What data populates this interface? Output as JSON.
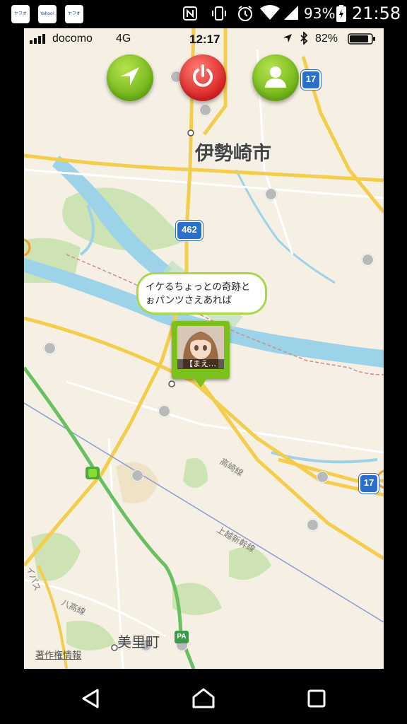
{
  "android_status": {
    "notifications": [
      "ヤフオク!",
      "Yahoo!カード",
      "ヤフオク!"
    ],
    "battery": "93%",
    "time": "21:58"
  },
  "ios_status": {
    "carrier": "docomo",
    "network": "4G",
    "time": "12:17",
    "battery": "82%"
  },
  "controls": {
    "locate_icon": "location-arrow-icon",
    "power_icon": "power-icon",
    "profile_icon": "person-icon"
  },
  "map": {
    "city_label": "伊勢崎市",
    "town_label": "美里町",
    "copyright_label": "著作権情報",
    "route_shields": [
      "17",
      "462",
      "17"
    ],
    "line_labels": [
      "高崎線",
      "上越新幹線",
      "八高線",
      "イパス"
    ],
    "pa_badge": "PA",
    "bubble_line1": "イケるちょっとの奇跡と",
    "bubble_line2": "ぉパンツさえあれば",
    "marker_name": "【まえ…"
  },
  "colors": {
    "map_bg": "#f5f0e3",
    "road_major": "#f5cd4c",
    "river": "#9cd3e8",
    "park": "#bcdca1",
    "accent_green": "#7cc01b",
    "power_red": "#d92424"
  }
}
